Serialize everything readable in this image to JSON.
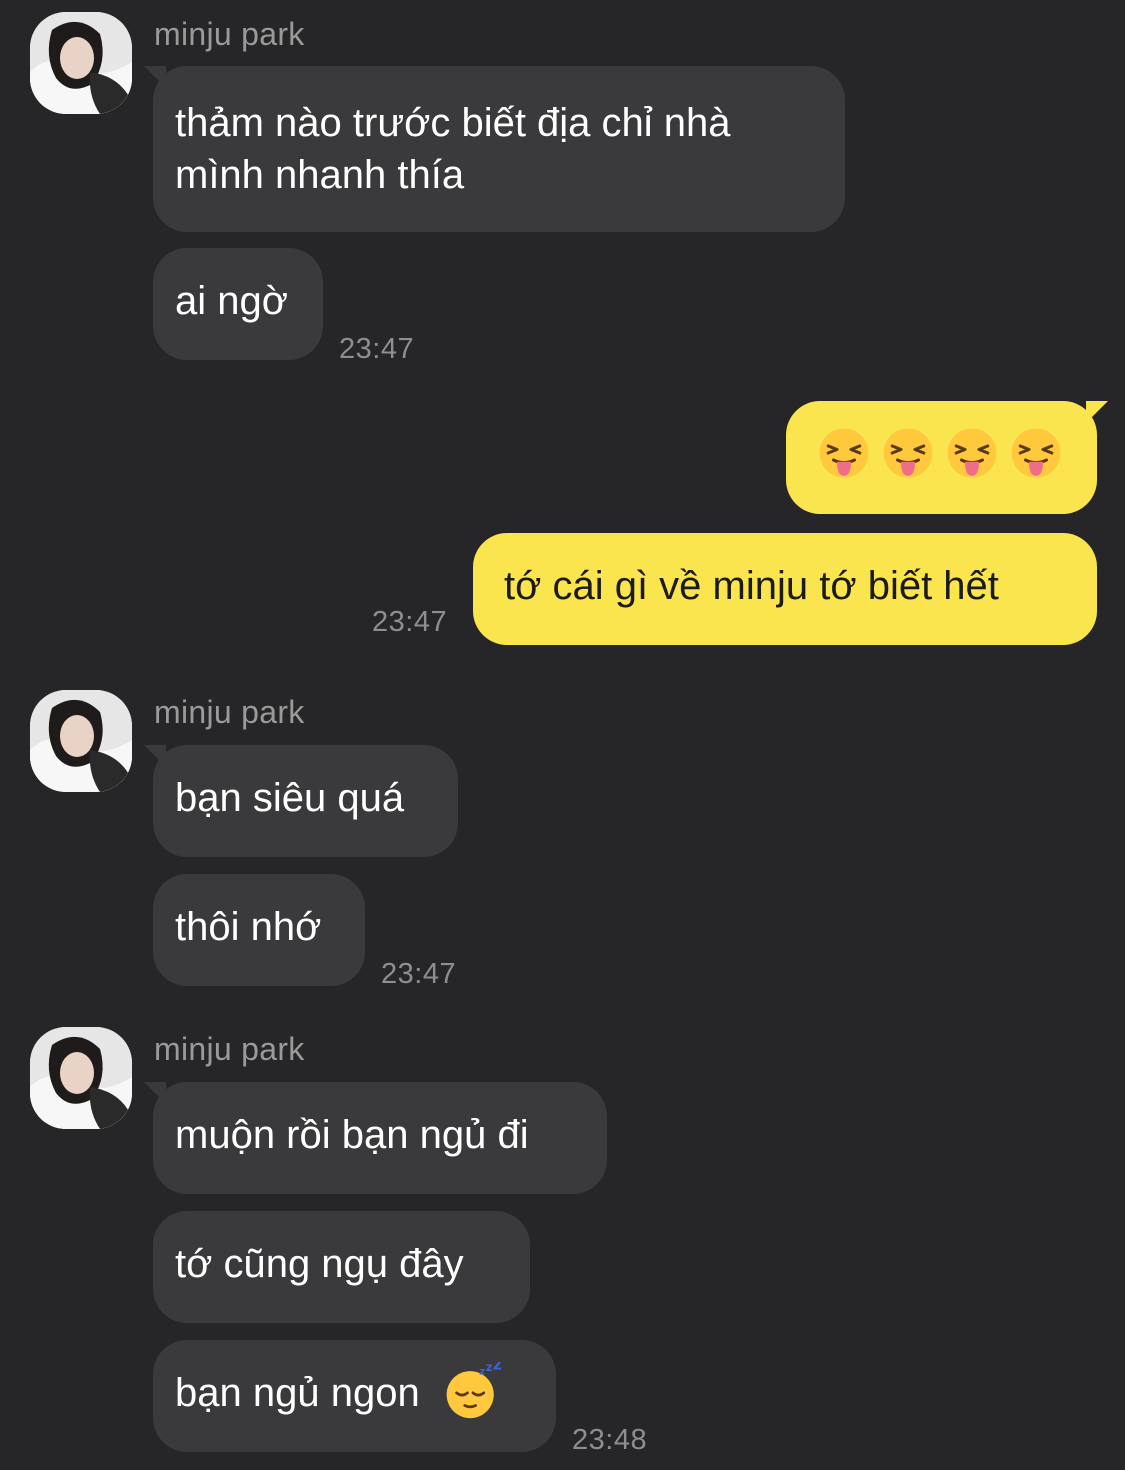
{
  "colors": {
    "background": "#262628",
    "incoming_bubble": "#3a3a3c",
    "outgoing_bubble": "#fae54e",
    "sender_name": "#9a9a9a",
    "timestamp": "#8e8e8e"
  },
  "groups": [
    {
      "sender": "minju park",
      "messages": [
        {
          "line1": "thảm nào trước biết địa chỉ nhà",
          "line2": "mình nhanh thía"
        },
        {
          "text": "ai ngờ"
        }
      ],
      "time": "23:47"
    },
    {
      "outgoing": true,
      "messages": [
        {
          "emoji": [
            "squinting-face-with-tongue",
            "squinting-face-with-tongue",
            "squinting-face-with-tongue",
            "squinting-face-with-tongue"
          ]
        },
        {
          "text": "tớ cái gì về minju tớ biết hết"
        }
      ],
      "time": "23:47"
    },
    {
      "sender": "minju park",
      "messages": [
        {
          "text": "bạn siêu quá"
        },
        {
          "text": "thôi nhớ"
        }
      ],
      "time": "23:47"
    },
    {
      "sender": "minju park",
      "messages": [
        {
          "text": "muộn rồi bạn ngủ đi"
        },
        {
          "text": "tớ cũng ngụ đây"
        },
        {
          "text": "bạn ngủ ngon",
          "emoji": "sleeping-face"
        }
      ],
      "time": "23:48"
    }
  ]
}
